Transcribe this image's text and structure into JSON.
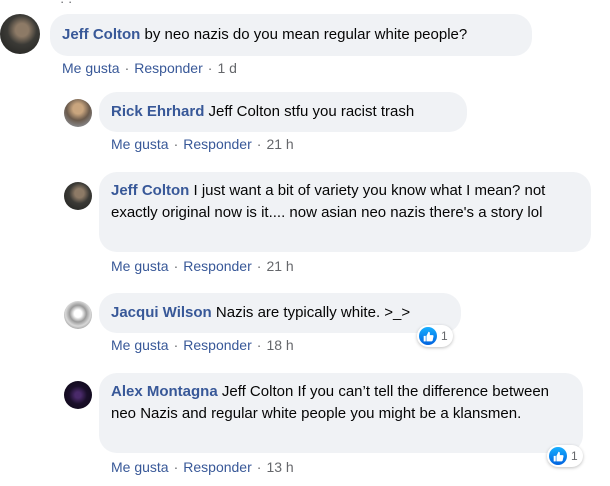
{
  "top_stub": "· ·",
  "comments": [
    {
      "author": "Jeff Colton",
      "text": "by neo nazis do you mean regular white people?",
      "actions": {
        "like": "Me gusta",
        "reply": "Responder",
        "time": "1 d"
      }
    },
    {
      "author": "Rick Ehrhard",
      "text": "Jeff Colton stfu you racist trash",
      "actions": {
        "like": "Me gusta",
        "reply": "Responder",
        "time": "21 h"
      }
    },
    {
      "author": "Jeff Colton",
      "text": "I just want a bit of variety you know what I mean? not exactly original now is it.... now asian neo nazis there's a story lol",
      "actions": {
        "like": "Me gusta",
        "reply": "Responder",
        "time": "21 h"
      }
    },
    {
      "author": "Jacqui Wilson",
      "text": "Nazis are typically white. >_>",
      "actions": {
        "like": "Me gusta",
        "reply": "Responder",
        "time": "18 h"
      },
      "reactions": "1"
    },
    {
      "author": "Alex Montagna",
      "text": "Jeff Colton If you can’t tell the difference between neo Nazis and regular white people you might be a klansmen.",
      "actions": {
        "like": "Me gusta",
        "reply": "Responder",
        "time": "13 h"
      },
      "reactions": "1"
    }
  ],
  "separator": "·",
  "colors": {
    "link": "#385898",
    "bubble": "#f0f2f5",
    "meta": "#65676b",
    "like_blue": "#0a7cff"
  }
}
